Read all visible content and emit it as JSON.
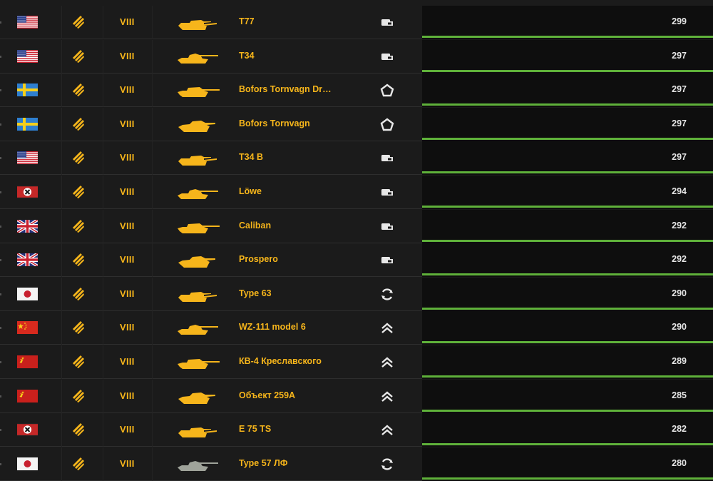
{
  "colors": {
    "accent": "#f6b51b",
    "bar": "#5fb13a",
    "value_text": "#e6e6e6"
  },
  "rows": [
    {
      "nation": "usa",
      "tier": "VIII",
      "name": "T77",
      "role": "medium-light-icon",
      "value": "299",
      "bar_fraction": 1.0
    },
    {
      "nation": "usa",
      "tier": "VIII",
      "name": "T34",
      "role": "medium-light-icon",
      "value": "297",
      "bar_fraction": 1.0
    },
    {
      "nation": "sweden",
      "tier": "VIII",
      "name": "Bofors Tornvagn Drakk...",
      "role": "pentagon-icon",
      "value": "297",
      "bar_fraction": 1.0
    },
    {
      "nation": "sweden",
      "tier": "VIII",
      "name": "Bofors Tornvagn",
      "role": "pentagon-icon",
      "value": "297",
      "bar_fraction": 1.0
    },
    {
      "nation": "usa",
      "tier": "VIII",
      "name": "T34 B",
      "role": "medium-light-icon",
      "value": "297",
      "bar_fraction": 1.0
    },
    {
      "nation": "germany",
      "tier": "VIII",
      "name": "Löwe",
      "role": "medium-light-icon",
      "value": "294",
      "bar_fraction": 1.0
    },
    {
      "nation": "uk",
      "tier": "VIII",
      "name": "Caliban",
      "role": "medium-light-icon",
      "value": "292",
      "bar_fraction": 1.0
    },
    {
      "nation": "uk",
      "tier": "VIII",
      "name": "Prospero",
      "role": "medium-light-icon",
      "value": "292",
      "bar_fraction": 1.0
    },
    {
      "nation": "japan",
      "tier": "VIII",
      "name": "Type 63",
      "role": "cycle-icon",
      "value": "290",
      "bar_fraction": 1.0
    },
    {
      "nation": "china",
      "tier": "VIII",
      "name": "WZ-111 model 6",
      "role": "double-chevron-icon",
      "value": "290",
      "bar_fraction": 1.0
    },
    {
      "nation": "ussr",
      "tier": "VIII",
      "name": "КВ-4 Креславского",
      "role": "double-chevron-icon",
      "value": "289",
      "bar_fraction": 1.0
    },
    {
      "nation": "ussr",
      "tier": "VIII",
      "name": "Объект 259А",
      "role": "double-chevron-icon",
      "value": "285",
      "bar_fraction": 1.0
    },
    {
      "nation": "germany",
      "tier": "VIII",
      "name": "E 75 TS",
      "role": "double-chevron-icon",
      "value": "282",
      "bar_fraction": 1.0
    },
    {
      "nation": "japan",
      "tier": "VIII",
      "name": "Type 57 ЛФ",
      "role": "cycle-icon",
      "value": "280",
      "bar_fraction": 1.0,
      "tank_color": "#9fa39a"
    }
  ]
}
